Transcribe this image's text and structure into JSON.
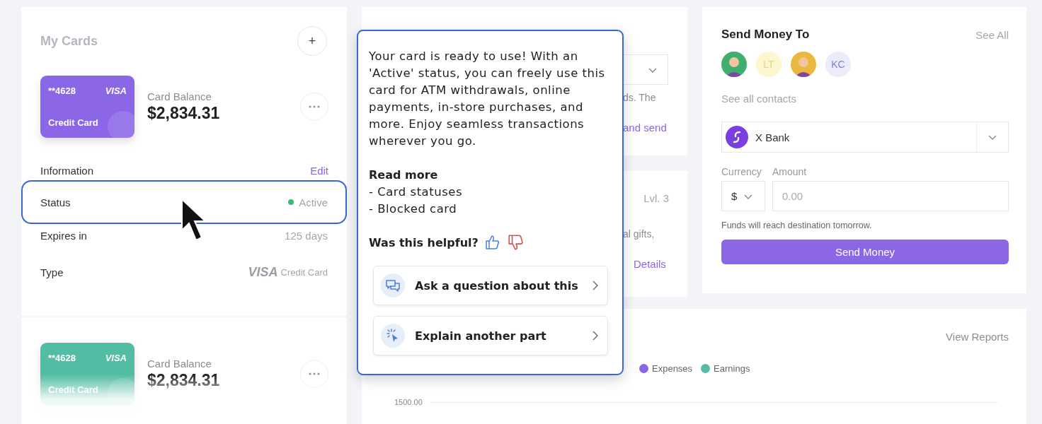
{
  "my_cards": {
    "title": "My Cards",
    "add_button": "+",
    "cards": [
      {
        "number": "**4628",
        "network": "VISA",
        "label": "Credit Card",
        "color": "#8b66e6",
        "balance_label": "Card Balance",
        "balance": "$2,834.31"
      },
      {
        "number": "**4628",
        "network": "VISA",
        "label": "Credit Card",
        "color": "#52bca4",
        "balance_label": "Card Balance",
        "balance": "$2,834.31"
      }
    ]
  },
  "information": {
    "title": "Information",
    "edit_link": "Edit",
    "rows": [
      {
        "label": "Status",
        "kind": "status",
        "value": "Active",
        "color": "#3dbd74",
        "highlighted": true
      },
      {
        "label": "Expires in",
        "kind": "text",
        "value": "125 days",
        "highlighted": false
      },
      {
        "label": "Type",
        "kind": "card_type",
        "brand": "VISA",
        "value": "Credit Card",
        "highlighted": false
      }
    ]
  },
  "transfer_card": {
    "text_fragment": "ds. The",
    "link_fragment": "and send"
  },
  "level_card": {
    "level_label": "Lvl. 3",
    "text_fragment": "al gifts,",
    "details_link": "Details"
  },
  "send_money": {
    "title": "Send Money To",
    "see_all": "See All",
    "contacts": [
      {
        "kind": "avatar",
        "color": "#3fae6e"
      },
      {
        "kind": "initials",
        "initials": "LT",
        "color": "#fdf6cf"
      },
      {
        "kind": "avatar",
        "color": "#e9b83c"
      },
      {
        "kind": "initials",
        "initials": "KC",
        "color": "#ecebfa"
      }
    ],
    "see_all_contacts": "See all contacts",
    "bank": "X Bank",
    "currency_label": "Currency",
    "amount_label": "Amount",
    "currency": "$",
    "amount_placeholder": "0.00",
    "note": "Funds will reach destination tomorrow.",
    "button": "Send Money"
  },
  "reports": {
    "view_reports": "View Reports",
    "legend": [
      {
        "name": "Expenses",
        "color": "#8b66e6"
      },
      {
        "name": "Earnings",
        "color": "#52bca4"
      }
    ],
    "y_tick": "1500.00"
  },
  "help_tooltip": {
    "body": "Your card is ready to use! With an 'Active' status, you can freely use this card for ATM withdrawals, online payments, in-store purchases, and more. Enjoy seamless transactions wherever you go.",
    "read_more_title": "Read more",
    "links": [
      "- Card statuses",
      "- Blocked card"
    ],
    "feedback_question": "Was this helpful?",
    "actions": [
      {
        "kind": "ask",
        "label": "Ask a question about this"
      },
      {
        "kind": "explain",
        "label": "Explain another part"
      }
    ]
  }
}
